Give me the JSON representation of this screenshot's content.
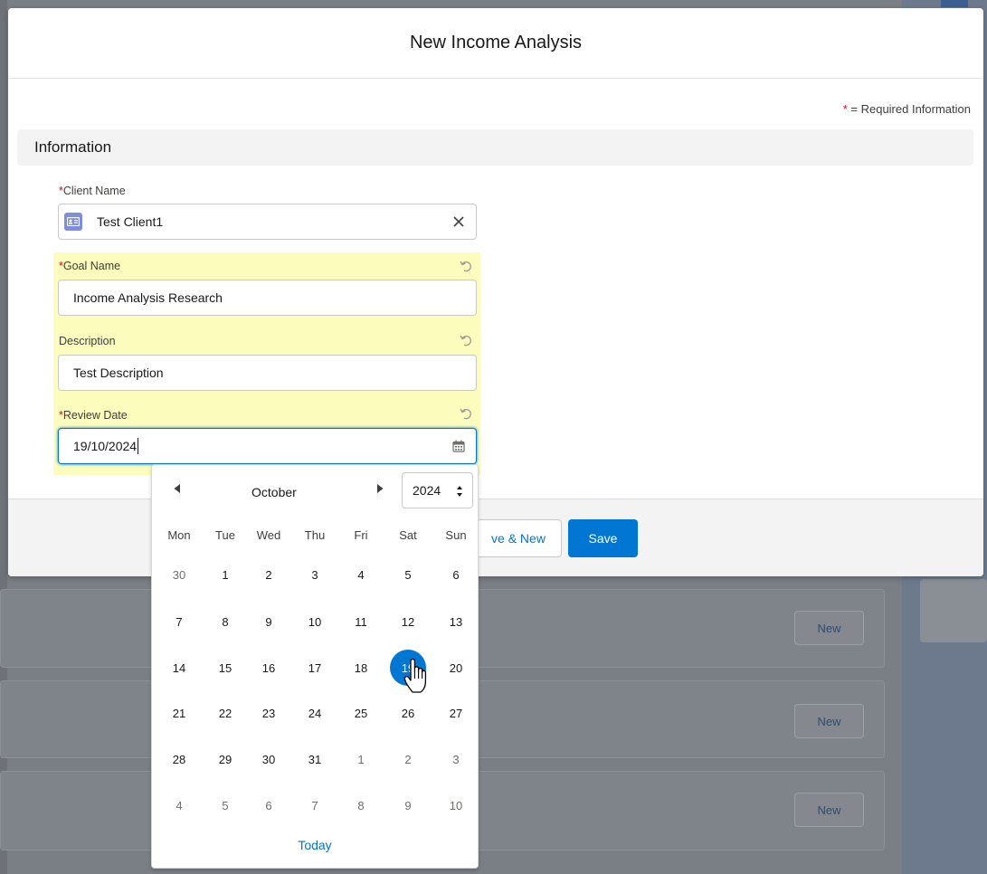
{
  "background": {
    "new_button_label": "New"
  },
  "modal": {
    "title": "New Income Analysis",
    "required_legend": "= Required Information",
    "required_star": "*",
    "section": "Information",
    "fields": {
      "client_name": {
        "label": "Client Name",
        "value": "Test Client1"
      },
      "goal_name": {
        "label": "Goal Name",
        "value": "Income Analysis Research"
      },
      "description": {
        "label": "Description",
        "value": "Test Description"
      },
      "review_date": {
        "label": "Review Date",
        "value": "19/10/2024"
      }
    },
    "footer": {
      "save_new_label": "ve & New",
      "save_label": "Save"
    }
  },
  "datepicker": {
    "month": "October",
    "year": "2024",
    "weekdays": [
      "Mon",
      "Tue",
      "Wed",
      "Thu",
      "Fri",
      "Sat",
      "Sun"
    ],
    "weeks": [
      [
        "30",
        "1",
        "2",
        "3",
        "4",
        "5",
        "6"
      ],
      [
        "7",
        "8",
        "9",
        "10",
        "11",
        "12",
        "13"
      ],
      [
        "14",
        "15",
        "16",
        "17",
        "18",
        "19",
        "20"
      ],
      [
        "21",
        "22",
        "23",
        "24",
        "25",
        "26",
        "27"
      ],
      [
        "28",
        "29",
        "30",
        "31",
        "1",
        "2",
        "3"
      ],
      [
        "4",
        "5",
        "6",
        "7",
        "8",
        "9",
        "10"
      ]
    ],
    "selected_day": "19",
    "today_label": "Today"
  },
  "colors": {
    "brand": "#0176d3",
    "required": "#ea001e",
    "highlight": "#fcfcbd"
  }
}
